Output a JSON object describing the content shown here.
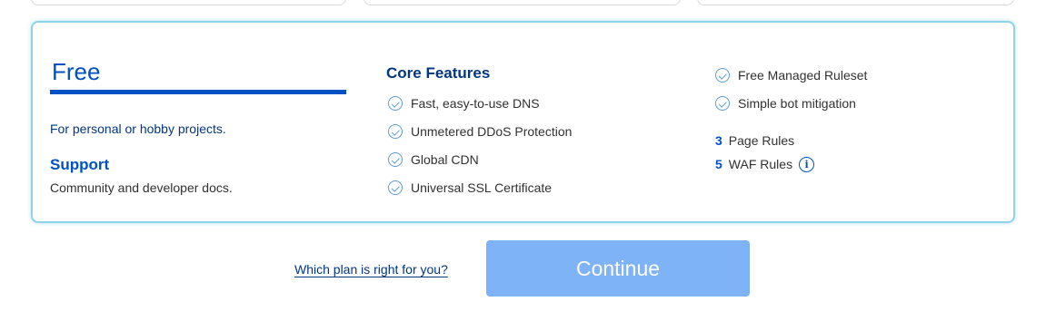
{
  "plan": {
    "name": "Free",
    "description": "For personal or hobby projects.",
    "support_title": "Support",
    "support_description": "Community and developer docs."
  },
  "core_features": {
    "title": "Core Features",
    "items": [
      "Fast, easy-to-use DNS",
      "Unmetered DDoS Protection",
      "Global CDN",
      "Universal SSL Certificate"
    ]
  },
  "extra_features": {
    "items": [
      "Free Managed Ruleset",
      "Simple bot mitigation"
    ],
    "limits": [
      {
        "count": "3",
        "label": "Page Rules"
      },
      {
        "count": "5",
        "label": "WAF Rules"
      }
    ]
  },
  "footer": {
    "help_link": "Which plan is right for you?",
    "continue_label": "Continue"
  },
  "icons": {
    "check": "check-circle-icon",
    "info": "info-icon"
  },
  "colors": {
    "accent": "#0051c3",
    "card_border": "#8fd3e8",
    "button_disabled": "#7fb3f7"
  }
}
